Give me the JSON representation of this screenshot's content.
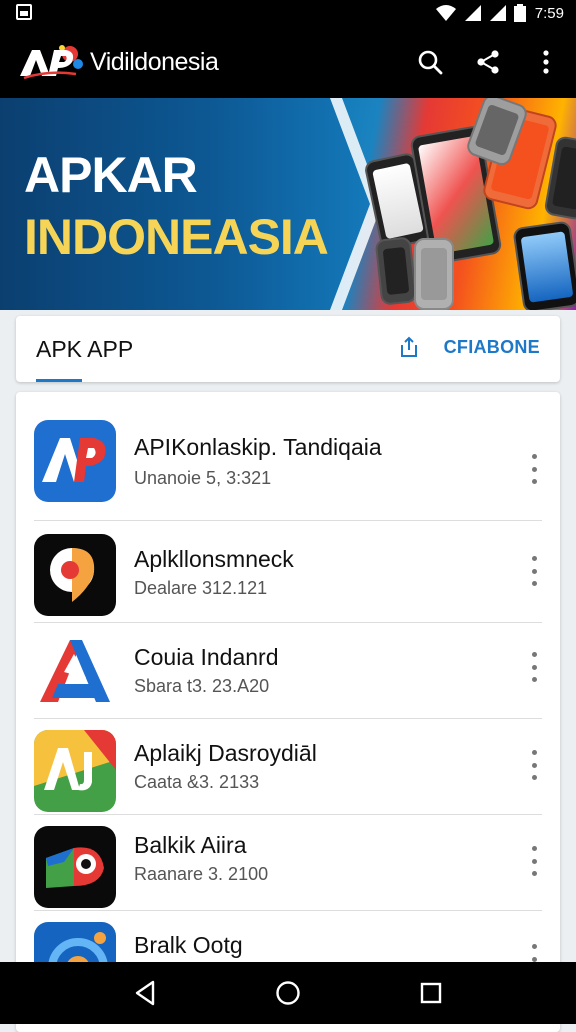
{
  "status_bar": {
    "time": "7:59",
    "icons": [
      "notification-icon",
      "wifi-icon",
      "signal-icon",
      "signal-icon",
      "battery-icon"
    ]
  },
  "app_bar": {
    "logo_text": "AP",
    "title": "Vidildonesia",
    "actions": [
      "search-icon",
      "share-icon",
      "more-vert-icon"
    ]
  },
  "banner": {
    "line1": "APKAR",
    "line2": "INDONEASIA",
    "colors": {
      "line1": "#ffffff",
      "line2": "#f6d455",
      "background": "#0d5a96"
    }
  },
  "tabs": {
    "label": "APK APP",
    "action_label": "CFIABONE",
    "action_icon": "share-upload-icon",
    "accent": "#1e78c8"
  },
  "apps": [
    {
      "name": "APIKonlaskip. Tandiqaia",
      "meta": "Unanoie 5, 3:321",
      "icon": "app-ap-icon"
    },
    {
      "name": "Aplkllonsmneck",
      "meta": "Dealare 312.121",
      "icon": "app-pin-icon"
    },
    {
      "name": "Couia Indanrd",
      "meta": "Sbara t3. 23.A20",
      "icon": "app-a-icon"
    },
    {
      "name": "Aplaikj Dasroydiāl",
      "meta": "Caata &3. 2133",
      "icon": "app-aj-icon"
    },
    {
      "name": "Balkik Aiira",
      "meta": "Raanare 3. 2100",
      "icon": "app-eye-icon"
    },
    {
      "name": "Bralk Ootg",
      "meta": "",
      "icon": "app-circle-icon"
    }
  ],
  "nav_bar": {
    "buttons": [
      "back-icon",
      "home-icon",
      "recents-icon"
    ]
  }
}
